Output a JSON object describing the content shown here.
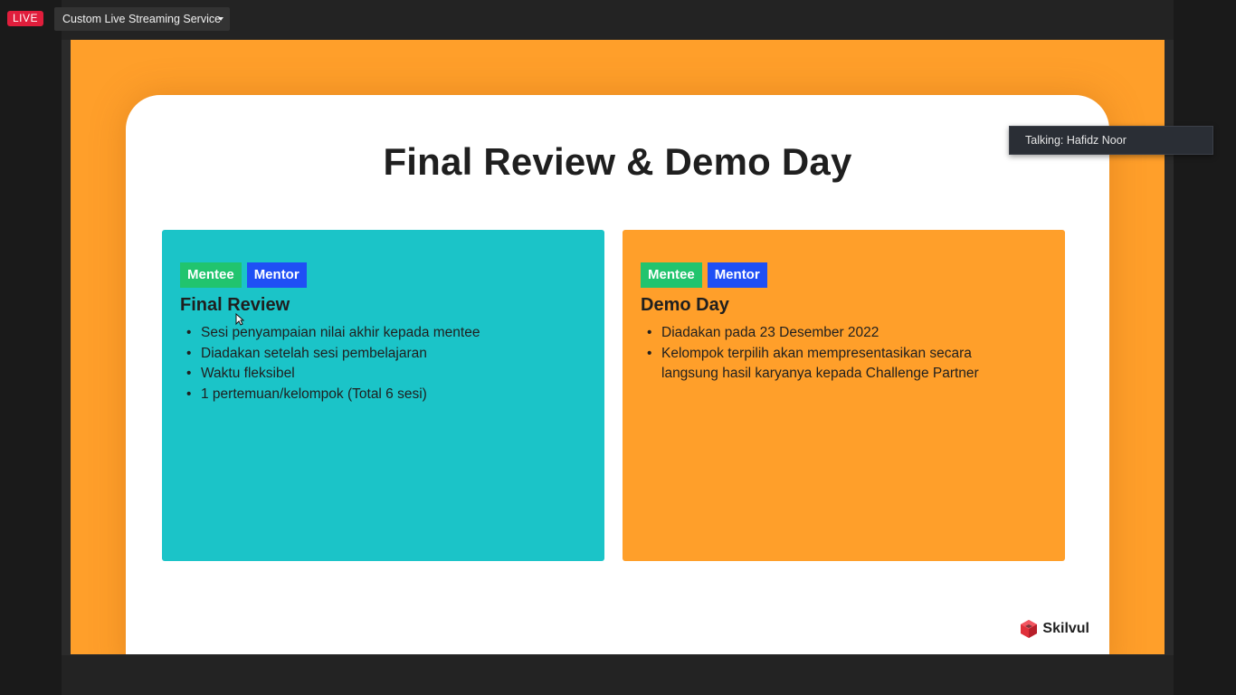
{
  "topbar": {
    "live_label": "LIVE",
    "stream_service": "Custom Live Streaming Service"
  },
  "slide": {
    "title": "Final Review & Demo Day",
    "panels": [
      {
        "tags": [
          "Mentee",
          "Mentor"
        ],
        "heading": "Final Review",
        "items": [
          "Sesi penyampaian nilai akhir kepada mentee",
          "Diadakan setelah sesi pembelajaran",
          "Waktu fleksibel",
          "1 pertemuan/kelompok (Total 6 sesi)"
        ]
      },
      {
        "tags": [
          "Mentee",
          "Mentor"
        ],
        "heading": "Demo Day",
        "items": [
          "Diadakan pada 23 Desember 2022",
          "Kelompok terpilih akan mempresentasikan secara langsung hasil karyanya kepada Challenge Partner"
        ]
      }
    ],
    "brand": "Skilvul"
  },
  "tooltip": {
    "talking": "Talking: Hafidz Noor"
  },
  "colors": {
    "live": "#e01e3c",
    "slide_bg": "#ff9f2a",
    "panel_teal": "#1bc4c8",
    "tag_mentee": "#21c46e",
    "tag_mentor": "#1f4ff5"
  },
  "icons": [
    "caret-down-icon",
    "skilvul-logo-icon",
    "mouse-cursor-icon"
  ]
}
